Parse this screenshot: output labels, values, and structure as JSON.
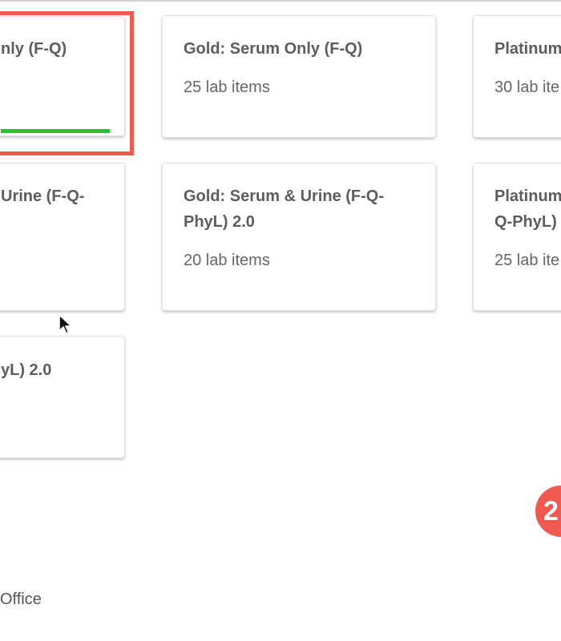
{
  "cards": [
    {
      "title": "nly (F-Q)",
      "subtitle": ""
    },
    {
      "title": "Gold: Serum Only (F-Q)",
      "subtitle": "25 lab items"
    },
    {
      "title": "Platinum",
      "subtitle": "30 lab ite"
    },
    {
      "title": "Urine (F-Q-",
      "subtitle": ""
    },
    {
      "title": "Gold: Serum & Urine (F-Q-\nPhyL) 2.0",
      "subtitle": "20 lab items"
    },
    {
      "title": "Platinum\nQ-PhyL) 2",
      "subtitle": "25 lab ite"
    },
    {
      "title": "yL) 2.0",
      "subtitle": ""
    }
  ],
  "selected_card_progress": 1.0,
  "step_badge": "2",
  "footer": {
    "text": "Office"
  },
  "colors": {
    "highlight": "#f05a50",
    "progress": "#27c133",
    "badge": "#f0594f"
  },
  "icons": {
    "cursor": "mouse-pointer-icon"
  }
}
